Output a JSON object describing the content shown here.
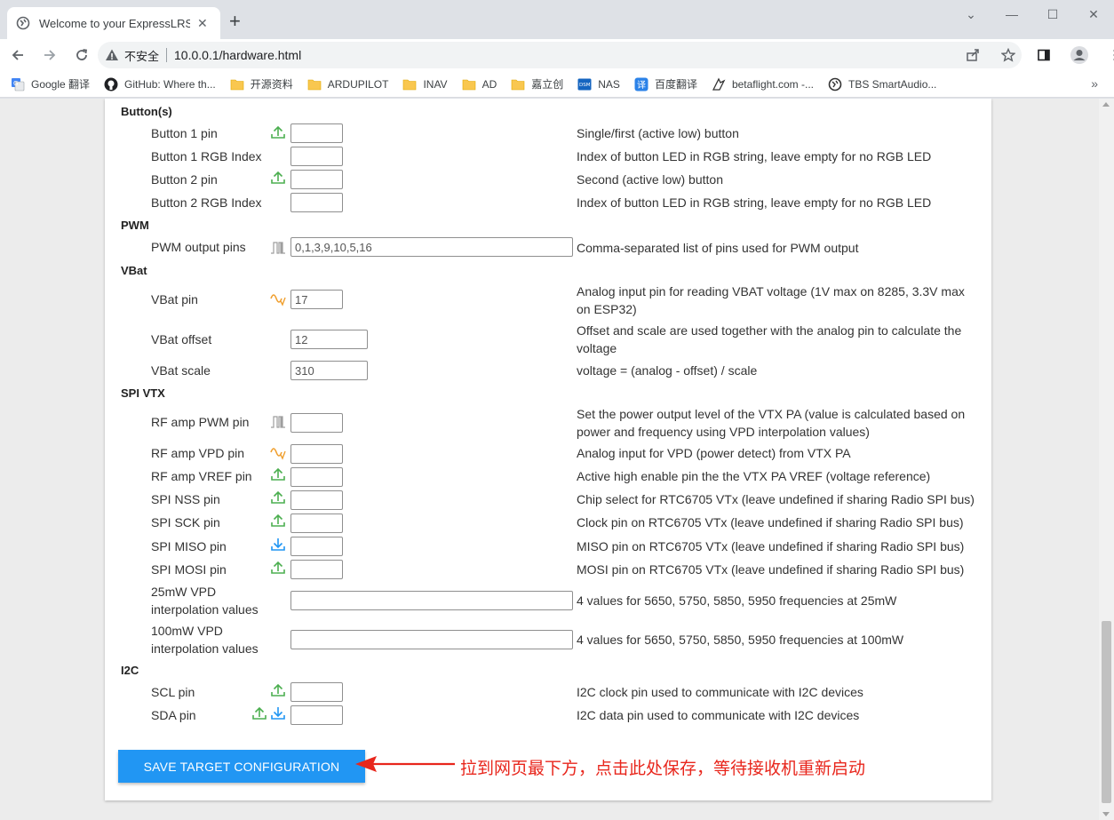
{
  "browser": {
    "tab_title": "Welcome to your ExpressLRS S",
    "insecure_label": "不安全",
    "url": "10.0.0.1/hardware.html",
    "bookmarks": [
      {
        "label": "Google 翻译",
        "icon": "google-translate-icon"
      },
      {
        "label": "GitHub: Where th...",
        "icon": "github-icon"
      },
      {
        "label": "开源资料",
        "icon": "folder-icon"
      },
      {
        "label": "ARDUPILOT",
        "icon": "folder-icon"
      },
      {
        "label": "INAV",
        "icon": "folder-icon"
      },
      {
        "label": "AD",
        "icon": "folder-icon"
      },
      {
        "label": "嘉立创",
        "icon": "folder-icon"
      },
      {
        "label": "NAS",
        "icon": "dsm-icon"
      },
      {
        "label": "百度翻译",
        "icon": "baidu-translate-icon"
      },
      {
        "label": "betaflight.com -...",
        "icon": "betaflight-icon"
      },
      {
        "label": "TBS SmartAudio...",
        "icon": "tbs-icon"
      }
    ],
    "more_label": "»"
  },
  "sections": {
    "buttons": "Button(s)",
    "pwm": "PWM",
    "vbat": "VBat",
    "spivtx": "SPI VTX",
    "i2c": "I2C"
  },
  "rows": {
    "btn1_pin": {
      "label": "Button 1 pin",
      "value": "",
      "desc": "Single/first (active low) button"
    },
    "btn1_rgb": {
      "label": "Button 1 RGB Index",
      "value": "",
      "desc": "Index of button LED in RGB string, leave empty for no RGB LED"
    },
    "btn2_pin": {
      "label": "Button 2 pin",
      "value": "",
      "desc": "Second (active low) button"
    },
    "btn2_rgb": {
      "label": "Button 2 RGB Index",
      "value": "",
      "desc": "Index of button LED in RGB string, leave empty for no RGB LED"
    },
    "pwm_pins": {
      "label": "PWM output pins",
      "value": "0,1,3,9,10,5,16",
      "desc": "Comma-separated list of pins used for PWM output"
    },
    "vbat_pin": {
      "label": "VBat pin",
      "value": "17",
      "desc": "Analog input pin for reading VBAT voltage (1V max on 8285, 3.3V max on ESP32)"
    },
    "vbat_offset": {
      "label": "VBat offset",
      "value": "12",
      "desc": "Offset and scale are used together with the analog pin to calculate the voltage"
    },
    "vbat_scale": {
      "label": "VBat scale",
      "value": "310",
      "desc": "voltage = (analog - offset) / scale"
    },
    "rf_pwm": {
      "label": "RF amp PWM pin",
      "value": "",
      "desc": "Set the power output level of the VTX PA (value is calculated based on power and frequency using VPD interpolation values)"
    },
    "rf_vpd": {
      "label": "RF amp VPD pin",
      "value": "",
      "desc": "Analog input for VPD (power detect) from VTX PA"
    },
    "rf_vref": {
      "label": "RF amp VREF pin",
      "value": "",
      "desc": "Active high enable pin the the VTX PA VREF (voltage reference)"
    },
    "spi_nss": {
      "label": "SPI NSS pin",
      "value": "",
      "desc": "Chip select for RTC6705 VTx (leave undefined if sharing Radio SPI bus)"
    },
    "spi_sck": {
      "label": "SPI SCK pin",
      "value": "",
      "desc": "Clock pin on RTC6705 VTx (leave undefined if sharing Radio SPI bus)"
    },
    "spi_miso": {
      "label": "SPI MISO pin",
      "value": "",
      "desc": "MISO pin on RTC6705 VTx (leave undefined if sharing Radio SPI bus)"
    },
    "spi_mosi": {
      "label": "SPI MOSI pin",
      "value": "",
      "desc": "MOSI pin on RTC6705 VTx (leave undefined if sharing Radio SPI bus)"
    },
    "vpd25": {
      "label": "25mW VPD interpolation values",
      "value": "",
      "desc": "4 values for 5650, 5750, 5850, 5950 frequencies at 25mW"
    },
    "vpd100": {
      "label": "100mW VPD interpolation values",
      "value": "",
      "desc": "4 values for 5650, 5750, 5850, 5950 frequencies at 100mW"
    },
    "scl": {
      "label": "SCL pin",
      "value": "",
      "desc": "I2C clock pin used to communicate with I2C devices"
    },
    "sda": {
      "label": "SDA pin",
      "value": "",
      "desc": "I2C data pin used to communicate with I2C devices"
    }
  },
  "save_button": "SAVE TARGET CONFIGURATION",
  "annotation": "拉到网页最下方，点击此处保存，等待接收机重新启动",
  "colors": {
    "output_icon": "#4caf50",
    "input_icon": "#2196f3",
    "analog_icon": "#f0a030",
    "pwm_icon": "#9e9e9e",
    "button": "#2196f3",
    "annotation": "#e8261c"
  }
}
